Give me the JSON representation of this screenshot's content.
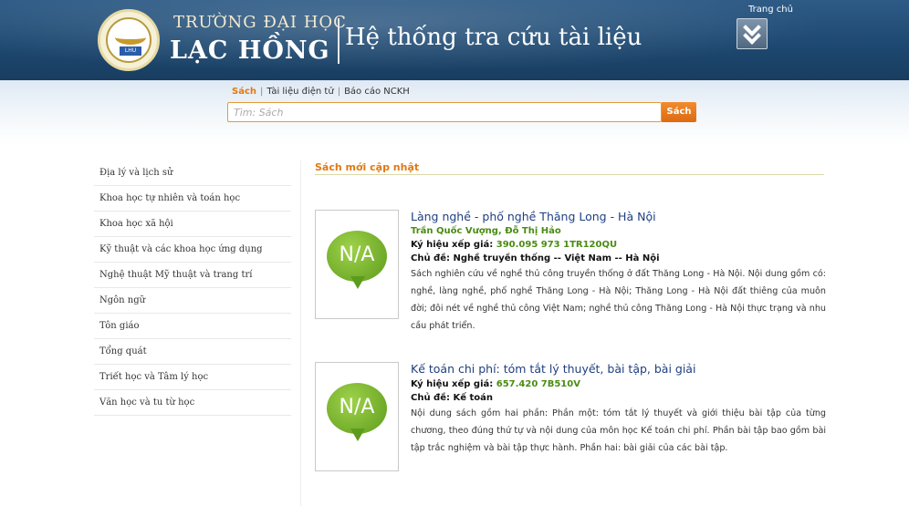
{
  "header": {
    "logo_alt": "LHU",
    "brand_line1": "TRƯỜNG ĐẠI HỌC",
    "brand_line2": "LẠC HỒNG",
    "app_title": "Hệ thống tra cứu tài liệu",
    "home_label": "Trang chủ"
  },
  "search": {
    "tabs": [
      "Sách",
      "Tài liệu điện tử",
      "Báo cáo NCKH"
    ],
    "active_tab": "Sách",
    "placeholder": "Tìm: Sách",
    "button_label": "Sách"
  },
  "sidebar": {
    "items": [
      {
        "label": "Địa lý và lịch sử"
      },
      {
        "label": "Khoa học tự nhiên và toán học"
      },
      {
        "label": "Khoa học xã hội"
      },
      {
        "label": "Kỹ thuật và các khoa học ứng dụng"
      },
      {
        "label": "Nghệ thuật Mỹ thuật và trang trí"
      },
      {
        "label": "Ngôn ngữ"
      },
      {
        "label": "Tôn giáo"
      },
      {
        "label": "Tổng quát"
      },
      {
        "label": "Triết học và Tâm lý học"
      },
      {
        "label": "Văn học và tu từ học"
      }
    ]
  },
  "main": {
    "section_title": "Sách mới cập nhật",
    "books": [
      {
        "thumbnail_text": "N/A",
        "title": "Làng nghề - phố nghề Thăng Long - Hà Nội",
        "authors": "Trần Quốc Vượng, Đỗ Thị Hảo",
        "call_number_label": "Ký hiệu xếp giá:",
        "call_number": "390.095 973 1TR120QU",
        "subject_label": "Chủ đề:",
        "subject": "Nghề truyền thống -- Việt Nam -- Hà Nội",
        "description": "Sách nghiên cứu về nghề thủ công truyền thống ở đất Thăng Long - Hà Nội. Nội dung gồm có: nghề, làng nghề, phố nghề Thăng Long - Hà Nội; Thăng Long - Hà Nội đất thiêng của muôn đời; đôi nét về nghề thủ công Việt Nam; nghề thủ công Thăng Long - Hà Nội thực trạng và nhu cầu phát triển."
      },
      {
        "thumbnail_text": "N/A",
        "title": "Kế toán chi phí: tóm tắt lý thuyết, bài tập, bài giải",
        "call_number_label": "Ký hiệu xếp giá:",
        "call_number": "657.420 7B510V",
        "subject_label": "Chủ đề:",
        "subject": "Kế toán",
        "description": "Nội dung sách gồm hai phần: Phần một: tóm tắt lý thuyết và giới thiệu bài tập của từng chương, theo đúng thứ tự và nội dung của môn học Kế toán chi phí. Phần bài tập bao gồm bài tập trắc nghiệm và bài tập thực hành. Phần hai: bài giải của các bài tập."
      }
    ]
  },
  "colors": {
    "header_bg": "#1f4a73",
    "accent_orange": "#e07a12",
    "title_blue": "#1f3f80",
    "green": "#4a8c12"
  }
}
